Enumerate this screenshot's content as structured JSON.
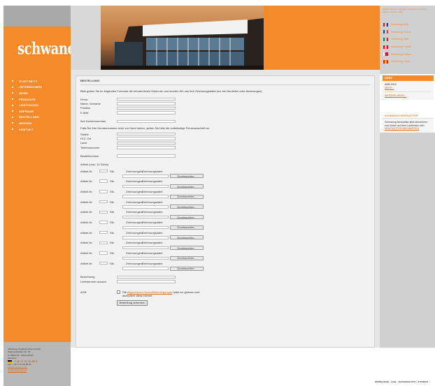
{
  "brand": {
    "logo_text": "schwanog"
  },
  "left_nav": {
    "items": [
      {
        "label": "STARTSEITE"
      },
      {
        "label": "UNTERNEHMEN"
      },
      {
        "label": "NEWS"
      },
      {
        "label": "PRODUKTE"
      },
      {
        "label": "LEISTUNGEN"
      },
      {
        "label": "ANFRAGE"
      },
      {
        "label": "BESTELLUNG"
      },
      {
        "label": "MESSEN"
      },
      {
        "label": "KONTAKT"
      }
    ]
  },
  "left_footer": {
    "lines": [
      "Schwanog Siegfried Güntert GmbH",
      "Niedereschacher Str. 36",
      "D-78052 VS - Obereschach",
      "Germany"
    ],
    "phone": "+ 49 77 21 94 89 0",
    "fax": "Fax: + 49 77 21 94 89 50",
    "email": "info@schwanog.com",
    "web": "www.schwanog.com"
  },
  "right_col": {
    "search_links": "Deutsch | English | Español | Français | Italiano | Polski | 中文",
    "languages": [
      {
        "label": "Schwanog USA",
        "flag_colors": [
          "#b22234",
          "#ffffff",
          "#3c3b6e"
        ]
      },
      {
        "label": "Schwanog France",
        "flag_colors": [
          "#0055a4",
          "#ffffff",
          "#ef4135"
        ]
      },
      {
        "label": "Schwanog Italia",
        "flag_colors": [
          "#009246",
          "#ffffff",
          "#ce2b37"
        ]
      },
      {
        "label": "Schwanog Turkey",
        "flag_colors": [
          "#e30a17",
          "#ffffff",
          "#e30a17"
        ]
      },
      {
        "label": "Schwanog Polska",
        "flag_colors": [
          "#ffffff",
          "#dc143c",
          "#dc143c"
        ]
      },
      {
        "label": "Schwanog China",
        "flag_colors": [
          "#de2910",
          "#ffde00",
          "#de2910"
        ]
      }
    ],
    "news": {
      "heading": "NEWS",
      "date": "AMB 2010",
      "more_link": "MEHR...",
      "all_link": "WEITERE NEWS..."
    },
    "newsletter": {
      "heading": "SCHWANOG NEWSLETTER",
      "text": "Schwanog Newsletter jetzt abonnieren und immer auf dem Laufenden sein.",
      "link": "NEWSLETTER ABONNIEREN"
    }
  },
  "form": {
    "title": "BESTELLUNG",
    "intro": "Bitte geben Sie im folgenden Formular die erforderlichen Daten ein und senden Sie uns Ihre Zeichnungsdatei (nur bei Neuteilen oder Änderungen).",
    "fields_top": [
      {
        "label": "Firma",
        "value": ""
      },
      {
        "label": "Name, Vorname",
        "value": ""
      },
      {
        "label": "Position",
        "value": ""
      },
      {
        "label": "E-Mail",
        "value": ""
      }
    ],
    "customer_no_label": "Ihre Kundennummer",
    "note": "Falls Sie Ihre Kundennummer nicht zur Hand haben, geben Sie bitte die vollständige Firmenanschrift an:",
    "fields_address": [
      {
        "label": "Straße",
        "value": ""
      },
      {
        "label": "PLZ, Ort",
        "value": ""
      },
      {
        "label": "Land",
        "value": ""
      },
      {
        "label": "Telefonnummer",
        "value": ""
      }
    ],
    "order_no_label": "Bestellnummer",
    "articles_label": "Artikel (max. 10 Stück)",
    "article_labels": {
      "art": "Artikel-Nr.",
      "qty": "Stk.",
      "drawno": "Zeichnungsnr.",
      "drawfile": "Zeichnungsdatei"
    },
    "browse_label": "Durchsuchen...",
    "article_count": 10,
    "remark_label": "Bemerkung",
    "delivery_label": "Liefertermin/-wunsch",
    "agb_label": "AGB",
    "agb_text_pre": "Die",
    "agb_link": "Allgemeinen Geschäftsbedingungen",
    "agb_text_post": "habe ich gelesen und akzeptiere diese hiermit.",
    "submit_label": "Bestellung anfordern"
  },
  "bottom_credit": "IMPRESSUM · AGB · DATENSCHUTZ · SITEMAP"
}
